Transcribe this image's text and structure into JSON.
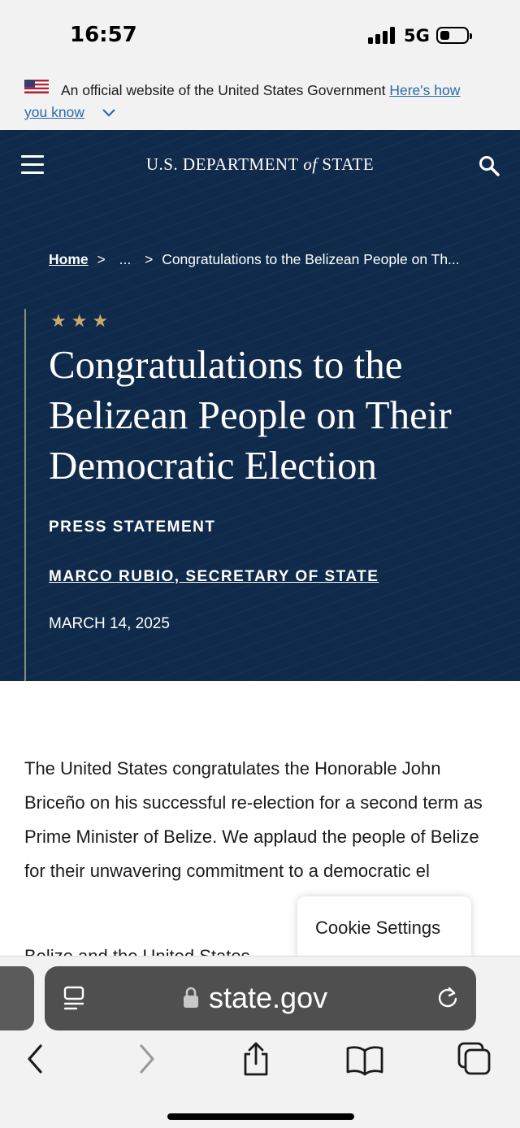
{
  "status_bar": {
    "time": "16:57",
    "network": "5G"
  },
  "gov_banner": {
    "text": "An official website of the United States Government",
    "link_part1": "Here's how",
    "link_part2": "you know"
  },
  "header": {
    "title_prefix": "U.S. DEPARTMENT",
    "title_of": "of",
    "title_suffix": "STATE"
  },
  "breadcrumb": {
    "home": "Home",
    "sep1": ">",
    "ellipsis": "...",
    "sep2": ">",
    "current": "Congratulations to the Belizean People on Th..."
  },
  "article": {
    "stars": "★★★",
    "headline": "Congratulations to the Belizean People on Their Democratic Election",
    "kind": "PRESS STATEMENT",
    "author": "MARCO RUBIO, SECRETARY OF STATE",
    "date": "MARCH 14, 2025",
    "body": "The United States congratulates the Honorable John Briceño on his successful re-election for a second term as Prime Minister of Belize.  We applaud the people of Belize for their unwavering commitment to a democratic el",
    "next_paragraph_partial": "Belize and the United States"
  },
  "cookie": {
    "label": "Cookie Settings"
  },
  "browser": {
    "url": "state.gov"
  },
  "colors": {
    "hero_bg": "#0f2a4a",
    "gold_accent": "#c9a96e",
    "link_blue": "#2b6aa8"
  }
}
